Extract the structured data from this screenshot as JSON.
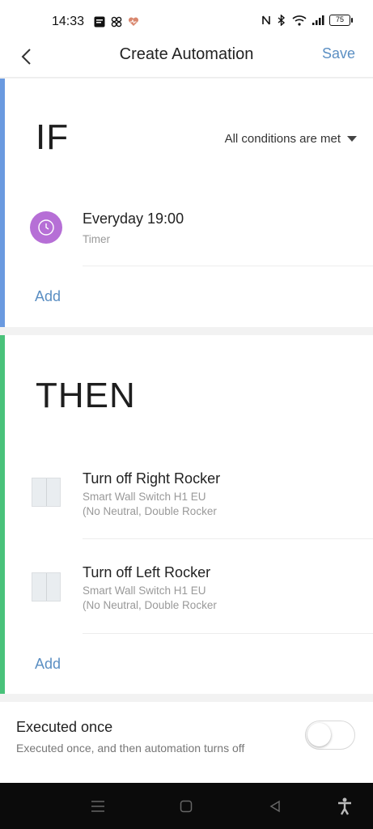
{
  "status_bar": {
    "time": "14:33",
    "battery": "75"
  },
  "header": {
    "title": "Create Automation",
    "save_label": "Save"
  },
  "if_section": {
    "label": "IF",
    "condition_mode": "All conditions are met",
    "conditions": [
      {
        "title": "Everyday 19:00",
        "subtitle": "Timer",
        "icon": "clock-icon"
      }
    ],
    "add_label": "Add",
    "accent_color": "#6a9ae0"
  },
  "then_section": {
    "label": "THEN",
    "actions": [
      {
        "title": "Turn off Right Rocker",
        "subtitle_line1": "Smart Wall Switch H1 EU",
        "subtitle_line2": "(No Neutral, Double Rocker",
        "icon": "wall-switch-icon"
      },
      {
        "title": "Turn off Left Rocker",
        "subtitle_line1": "Smart Wall Switch H1 EU",
        "subtitle_line2": "(No Neutral, Double Rocker",
        "icon": "wall-switch-icon"
      }
    ],
    "add_label": "Add",
    "accent_color": "#49c27a"
  },
  "executed_once": {
    "title": "Executed once",
    "description": "Executed once, and then automation turns off",
    "enabled": false
  },
  "colors": {
    "link": "#5b8fc3",
    "timer_icon_bg": "#b66fd6"
  }
}
